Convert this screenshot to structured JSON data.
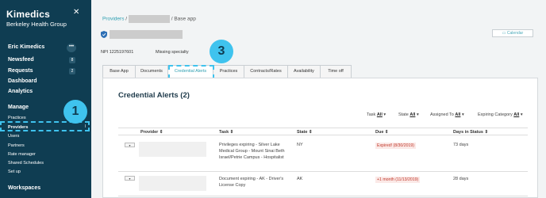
{
  "sidebar": {
    "brand_prefix": "Ki",
    "brand_suffix": "medics",
    "org": "Berkeley Health Group",
    "close": "✕",
    "user": "Eric Kimedics",
    "user_menu": "•••",
    "nav": [
      {
        "label": "Newsfeed",
        "badge": "8"
      },
      {
        "label": "Requests",
        "badge": "2"
      },
      {
        "label": "Dashboard",
        "badge": ""
      },
      {
        "label": "Analytics",
        "badge": ""
      }
    ],
    "manage_title": "Manage",
    "manage_items": [
      "Practices",
      "Providers",
      "Users",
      "Partners",
      "Rate manager",
      "Shared Schedules",
      "Set up"
    ],
    "workspaces_title": "Workspaces",
    "active_item_mark": "I"
  },
  "callouts": {
    "one": "1",
    "three": "3"
  },
  "breadcrumb": {
    "link": "Providers",
    "sep1": "/",
    "sep2": "/",
    "current": "Base app"
  },
  "header": {
    "calendar": "Calendar",
    "npi": "NPI 1225197601",
    "missing": "Missing specialty"
  },
  "tabs": [
    "Base App",
    "Documents",
    "Credential Alerts",
    "Practices",
    "Contracts/Rates",
    "Availability",
    "Time off"
  ],
  "active_tab": "Credential Alerts",
  "panel": {
    "title": "Credential Alerts (2)"
  },
  "filters": [
    {
      "label": "Task",
      "value": "All"
    },
    {
      "label": "State",
      "value": "All"
    },
    {
      "label": "Assigned To",
      "value": "All"
    },
    {
      "label": "Expiring Category",
      "value": "All"
    }
  ],
  "table": {
    "headers": [
      "Provider",
      "Task",
      "State",
      "Due",
      "Days in Status"
    ],
    "rows": [
      {
        "task": "Privileges expiring - Silver Lake Medical Group - Mount Sinai Beth Israel/Petrie Campus - Hospitalist",
        "state": "NY",
        "due": "Expired! (8/30/2019)",
        "days": "73 days"
      },
      {
        "task": "Document expiring - AK - Driver's License Copy",
        "state": "AK",
        "due": "+1 month (11/13/2019)",
        "days": "28 days"
      }
    ]
  }
}
